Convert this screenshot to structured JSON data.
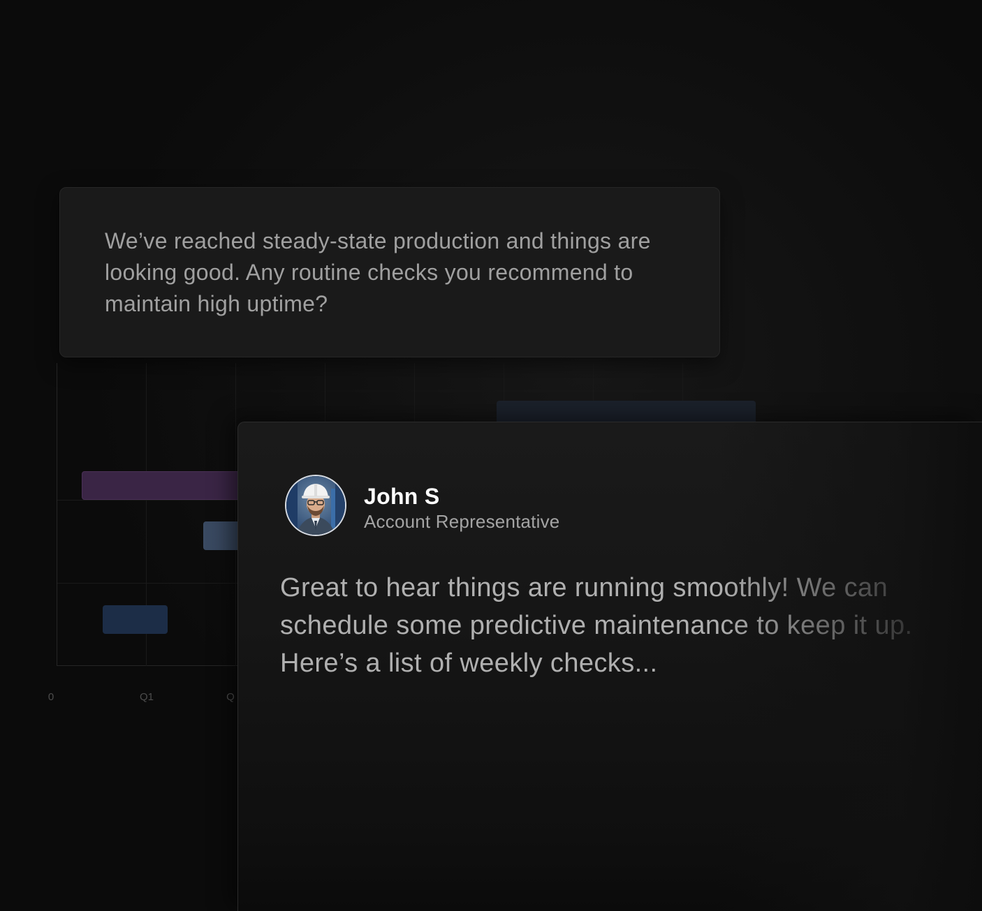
{
  "chart": {
    "x_ticks": [
      "0",
      "Q1",
      "Q"
    ]
  },
  "chart_data": {
    "type": "bar",
    "orientation": "horizontal",
    "x_ticks": [
      "0",
      "Q1",
      "Q"
    ],
    "grid": true,
    "colors": [
      "#3a2545",
      "#3a4a62",
      "#1c2d47",
      "#1b212b"
    ]
  },
  "user_message": {
    "text": "We’ve reached steady-state production and things are looking good. Any routine checks you recommend to maintain high uptime?"
  },
  "reply": {
    "name": "John S",
    "role": "Account Representative",
    "avatar_icon": "worker-hardhat-avatar",
    "text": "Great to hear things are running smoothly! We can schedule some predictive maintenance to keep it up. Here’s a list of weekly checks..."
  },
  "colors": {
    "background": "#0b0b0b",
    "card": "#1a1a1a",
    "name_text": "#ffffff",
    "body_text": "#b0b0b0"
  }
}
